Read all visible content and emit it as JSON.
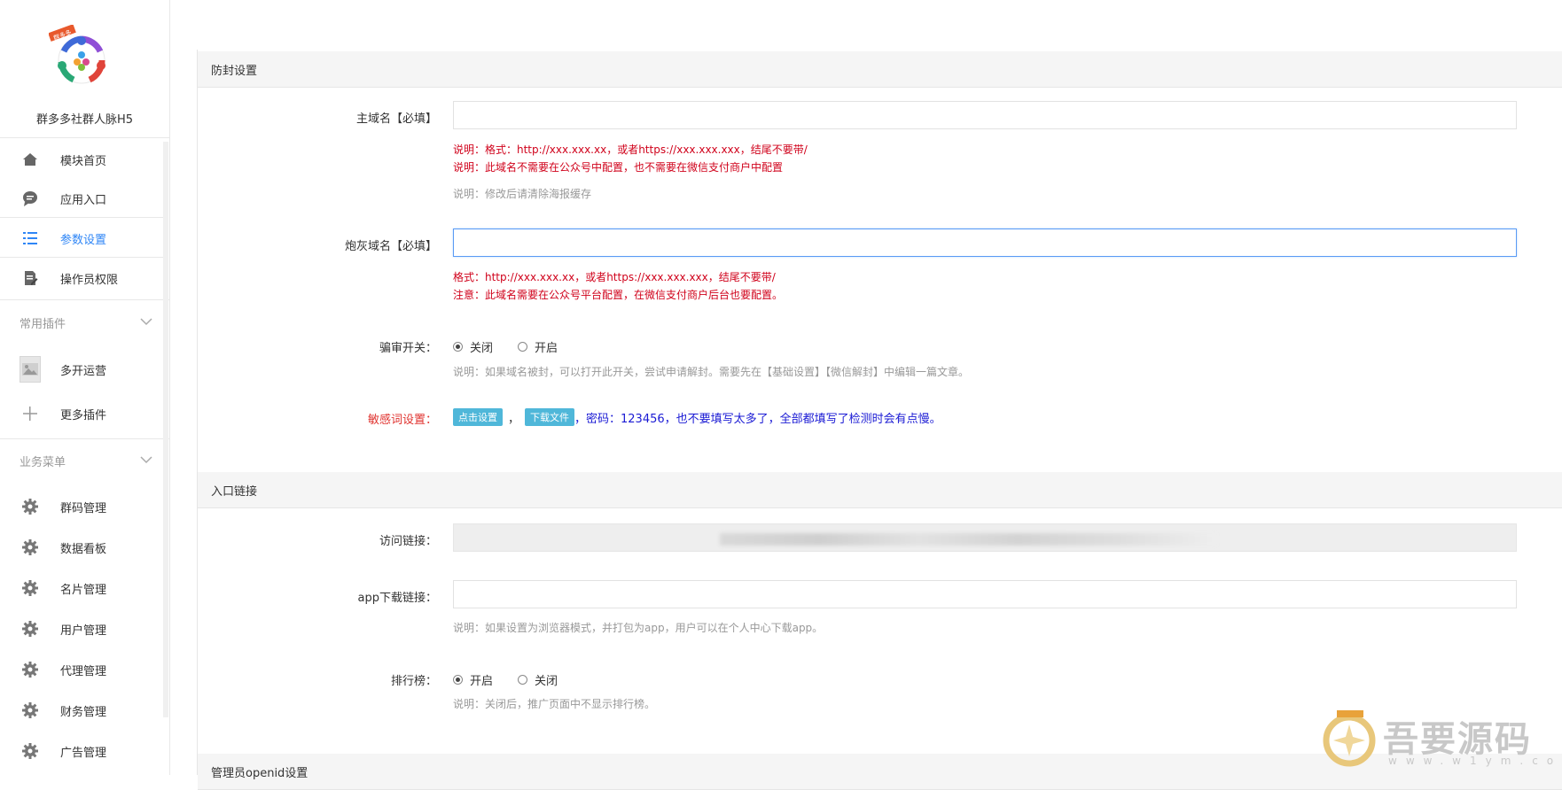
{
  "app": {
    "name": "群多多社群人脉H5",
    "logo_badge": "群多多"
  },
  "sidebar": {
    "nav": [
      {
        "label": "模块首页",
        "icon": "home-icon"
      },
      {
        "label": "应用入口",
        "icon": "chat-bubble-icon"
      },
      {
        "label": "参数设置",
        "icon": "list-settings-icon",
        "active": true
      },
      {
        "label": "操作员权限",
        "icon": "document-edit-icon"
      }
    ],
    "group_plugins": "常用插件",
    "plugins": [
      {
        "label": "多开运营",
        "icon": "image-thumbnail-icon"
      },
      {
        "label": "更多插件",
        "icon": "plus-icon"
      }
    ],
    "group_business": "业务菜单",
    "business": [
      {
        "label": "群码管理",
        "icon": "gear-icon"
      },
      {
        "label": "数据看板",
        "icon": "gear-icon"
      },
      {
        "label": "名片管理",
        "icon": "gear-icon"
      },
      {
        "label": "用户管理",
        "icon": "gear-icon"
      },
      {
        "label": "代理管理",
        "icon": "gear-icon"
      },
      {
        "label": "财务管理",
        "icon": "gear-icon"
      },
      {
        "label": "广告管理",
        "icon": "gear-icon"
      }
    ]
  },
  "sections": {
    "anti_block": {
      "title": "防封设置",
      "main_domain": {
        "label": "主域名【必填】",
        "value": "",
        "note1": "说明：格式：http://xxx.xxx.xx，或者https://xxx.xxx.xxx，结尾不要带/",
        "note2": "说明：此域名不需要在公众号中配置，也不需要在微信支付商户中配置",
        "note3": "说明：修改后请清除海报缓存"
      },
      "cannon_domain": {
        "label": "炮灰域名【必填】",
        "value": "",
        "note1": "格式：http://xxx.xxx.xx，或者https://xxx.xxx.xxx，结尾不要带/",
        "note2": "注意：此域名需要在公众号平台配置，在微信支付商户后台也要配置。"
      },
      "review_switch": {
        "label": "骗审开关：",
        "options": [
          "关闭",
          "开启"
        ],
        "selected": "关闭",
        "note": "说明：如果域名被封，可以打开此开关，尝试申请解封。需要先在【基础设置】【微信解封】中编辑一篇文章。"
      },
      "sensitive": {
        "label": "敏感词设置：",
        "btn_set": "点击设置",
        "sep": "，",
        "btn_download": "下载文件",
        "text": "，密码：123456，也不要填写太多了，全部都填写了检测时会有点慢。"
      }
    },
    "entry": {
      "title": "入口链接",
      "visit_link": {
        "label": "访问链接："
      },
      "app_link": {
        "label": "app下载链接：",
        "value": "",
        "note": "说明：如果设置为浏览器模式，并打包为app，用户可以在个人中心下载app。"
      },
      "ranking": {
        "label": "排行榜：",
        "options": [
          "开启",
          "关闭"
        ],
        "selected": "开启",
        "note": "说明：关闭后，推广页面中不显示排行榜。"
      }
    },
    "openid": {
      "title": "管理员openid设置"
    }
  },
  "watermark": {
    "text": "吾要源码",
    "sub": "www.w1ym.com"
  },
  "colors": {
    "accent": "#2f86f6",
    "danger": "#d0021b",
    "tag": "#4fb7d9",
    "link_text": "#1a1ad4"
  }
}
